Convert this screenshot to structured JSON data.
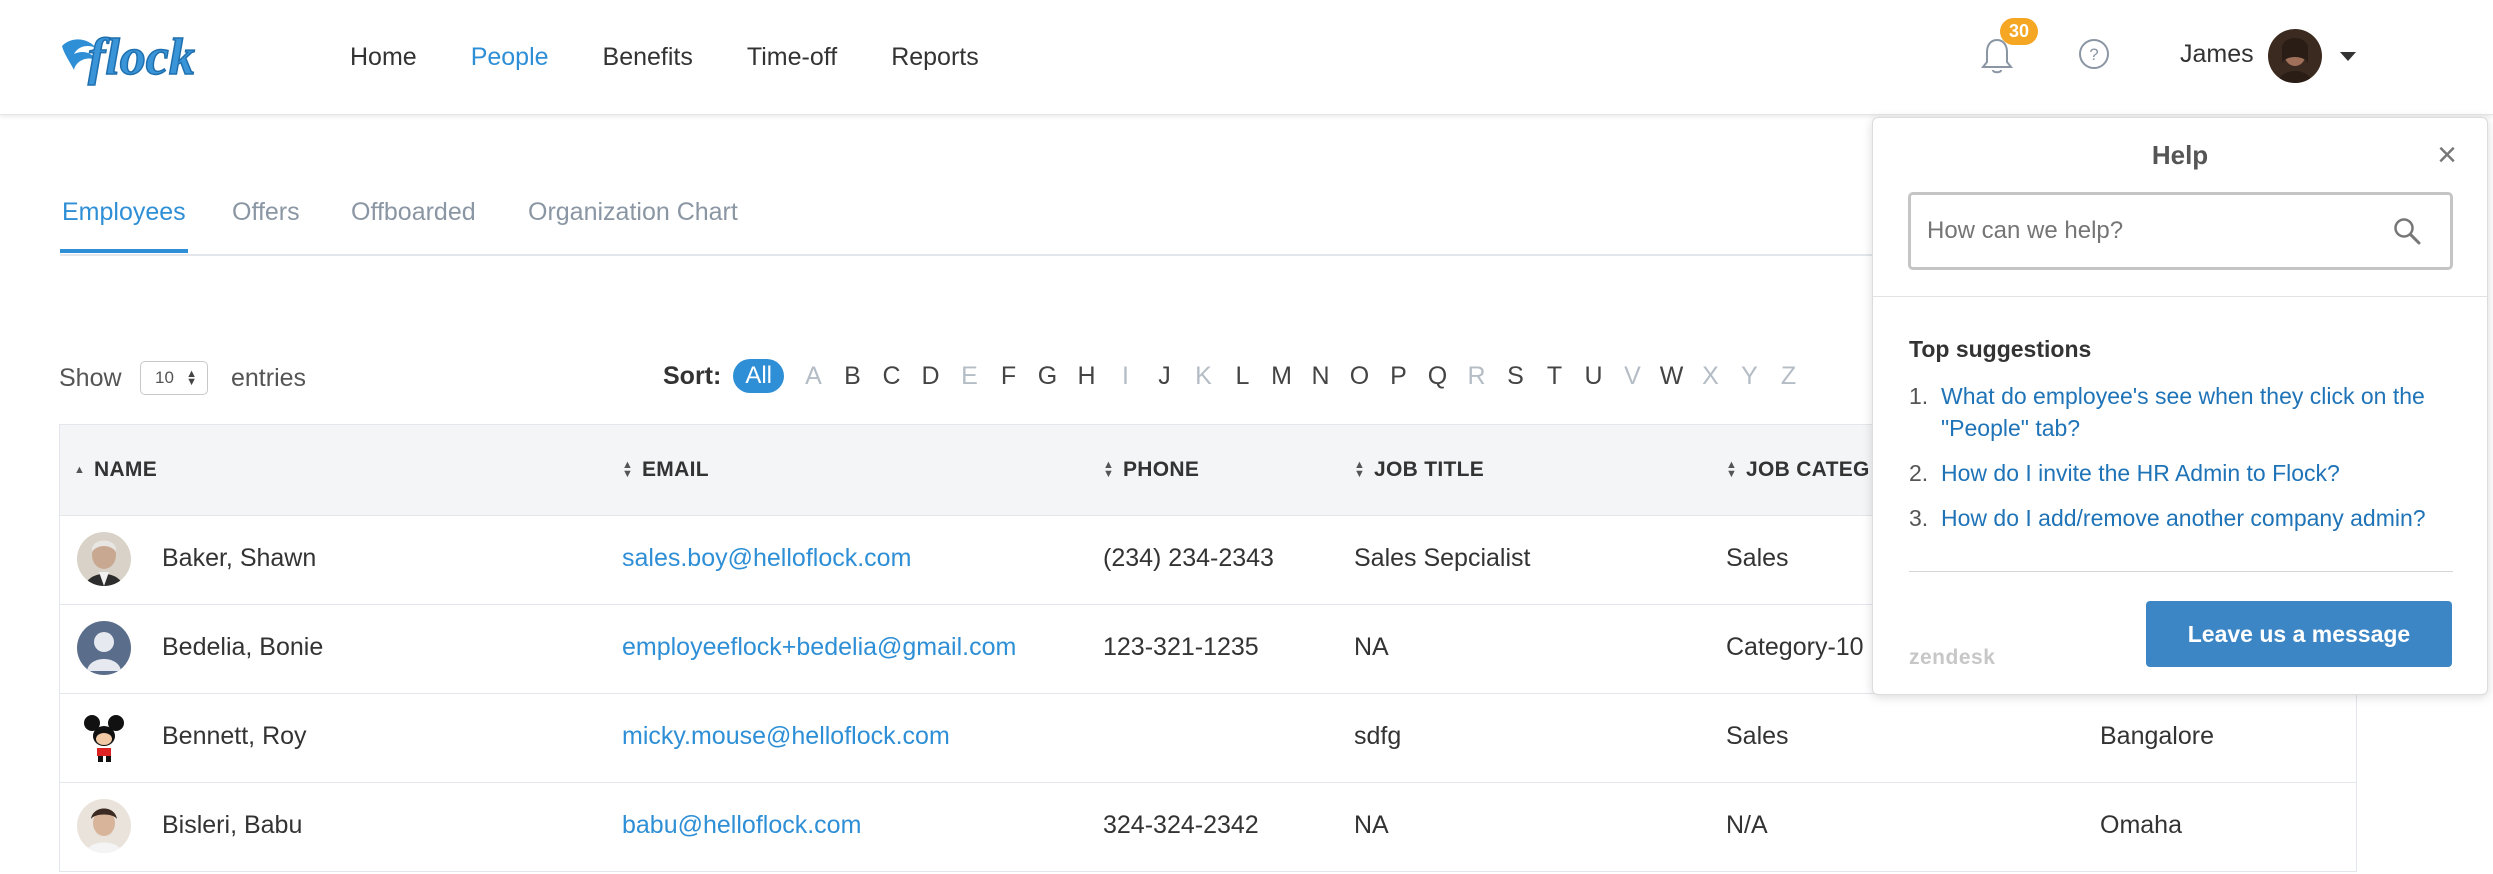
{
  "header": {
    "logo_text": "flock",
    "nav": [
      {
        "label": "Home"
      },
      {
        "label": "People"
      },
      {
        "label": "Benefits"
      },
      {
        "label": "Time-off"
      },
      {
        "label": "Reports"
      }
    ],
    "active_nav": "People",
    "notifications_count": "30",
    "user_name": "James"
  },
  "subtabs": [
    {
      "label": "Employees"
    },
    {
      "label": "Offers"
    },
    {
      "label": "Offboarded"
    },
    {
      "label": "Organization Chart"
    }
  ],
  "entries": {
    "show_label": "Show",
    "value": "10",
    "entries_label": "entries"
  },
  "sort": {
    "label": "Sort:",
    "all_label": "All",
    "letters": [
      {
        "l": "A",
        "dim": true
      },
      {
        "l": "B",
        "dim": false
      },
      {
        "l": "C",
        "dim": false
      },
      {
        "l": "D",
        "dim": false
      },
      {
        "l": "E",
        "dim": true
      },
      {
        "l": "F",
        "dim": false
      },
      {
        "l": "G",
        "dim": false
      },
      {
        "l": "H",
        "dim": false
      },
      {
        "l": "I",
        "dim": true
      },
      {
        "l": "J",
        "dim": false
      },
      {
        "l": "K",
        "dim": true
      },
      {
        "l": "L",
        "dim": false
      },
      {
        "l": "M",
        "dim": false
      },
      {
        "l": "N",
        "dim": false
      },
      {
        "l": "O",
        "dim": false
      },
      {
        "l": "P",
        "dim": false
      },
      {
        "l": "Q",
        "dim": false
      },
      {
        "l": "R",
        "dim": true
      },
      {
        "l": "S",
        "dim": false
      },
      {
        "l": "T",
        "dim": false
      },
      {
        "l": "U",
        "dim": false
      },
      {
        "l": "V",
        "dim": true
      },
      {
        "l": "W",
        "dim": false
      },
      {
        "l": "X",
        "dim": true
      },
      {
        "l": "Y",
        "dim": true
      },
      {
        "l": "Z",
        "dim": true
      }
    ]
  },
  "table": {
    "columns": [
      "NAME",
      "EMAIL",
      "PHONE",
      "JOB TITLE",
      "JOB CATEG"
    ],
    "rows": [
      {
        "name": "Baker, Shawn",
        "email": "sales.boy@helloflock.com",
        "phone": "(234) 234-2343",
        "job_title": "Sales Sepcialist",
        "job_category": "Sales",
        "location": ""
      },
      {
        "name": "Bedelia, Bonie",
        "email": "employeeflock+bedelia@gmail.com",
        "phone": "123-321-1235",
        "job_title": "NA",
        "job_category": "Category-10",
        "location": ""
      },
      {
        "name": "Bennett, Roy",
        "email": "micky.mouse@helloflock.com",
        "phone": "",
        "job_title": "sdfg",
        "job_category": "Sales",
        "location": "Bangalore"
      },
      {
        "name": "Bisleri, Babu",
        "email": "babu@helloflock.com",
        "phone": "324-324-2342",
        "job_title": "NA",
        "job_category": "N/A",
        "location": "Omaha"
      }
    ]
  },
  "help": {
    "title": "Help",
    "search_placeholder": "How can we help?",
    "suggestions_title": "Top suggestions",
    "suggestions": [
      {
        "num": "1.",
        "text": "What do employee's see when they click on the \"People\" tab?"
      },
      {
        "num": "2.",
        "text": "How do I invite the HR Admin to Flock?"
      },
      {
        "num": "3.",
        "text": "How do I add/remove another company admin?"
      }
    ],
    "footer_brand": "zendesk",
    "leave_message_label": "Leave us a message"
  },
  "colors": {
    "accent": "#2e8fd6",
    "badge": "#f5a623",
    "help_button": "#3d86c6"
  }
}
